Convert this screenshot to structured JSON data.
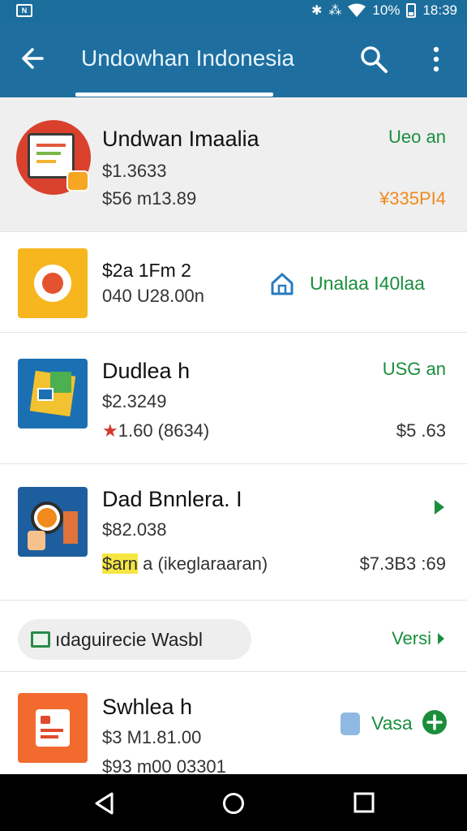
{
  "status_bar": {
    "left_badge": "N",
    "battery_percent": "10%",
    "time": "18:39"
  },
  "app_bar": {
    "title": "Undowhan Indonesia"
  },
  "items": [
    {
      "name": "Undwan Imaalia",
      "line2": "$1.3633",
      "line3": "$56 m13.89",
      "right_top": "Ueo an",
      "right_bottom": "¥335PI4"
    },
    {
      "name": "$2a 1Fm 2",
      "line2": "040 U28.00n",
      "right_label": "Unalaa I40laa"
    },
    {
      "name": "Dudlea h",
      "line2": "$2.3249",
      "line3_star": "★",
      "line3": "1.60 (8634)",
      "right_top": "USG an",
      "right_bottom": "$5 .63"
    },
    {
      "name": "Dad Bnnlera. I",
      "line2": "$82.038",
      "line3_highlight": "$arn",
      "line3": " a (ikeglaraaran)",
      "right_bottom": "$7.3B3 :69"
    },
    {
      "name": "Swhlea h",
      "line2": "$3 M1.81.00",
      "line3": "$93 m00 03301",
      "right_label": "Vasa"
    }
  ],
  "chip": {
    "label": "ıdaguirecie Wasbl",
    "right_link": "Versi"
  },
  "colors": {
    "app_bar": "#1e6fa0",
    "accent_green": "#1a8e3c",
    "price_orange": "#f08a1c"
  }
}
